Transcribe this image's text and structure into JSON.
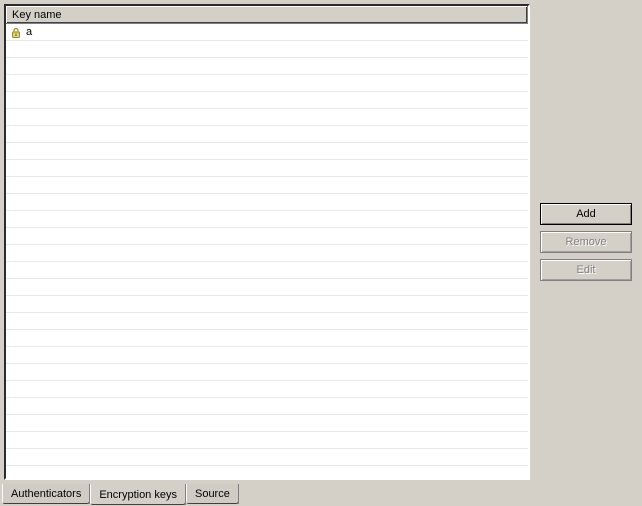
{
  "header": {
    "column_label": "Key name"
  },
  "list": {
    "items": [
      {
        "icon": "lock",
        "name": "a"
      }
    ]
  },
  "buttons": {
    "add": "Add",
    "remove": "Remove",
    "edit": "Edit"
  },
  "tabs": {
    "items": [
      {
        "label": "Authenticators",
        "active": false
      },
      {
        "label": "Encryption keys",
        "active": true
      },
      {
        "label": "Source",
        "active": false
      }
    ]
  },
  "colors": {
    "surface": "#d4d0c8",
    "grid_line": "#e8e8e8"
  }
}
